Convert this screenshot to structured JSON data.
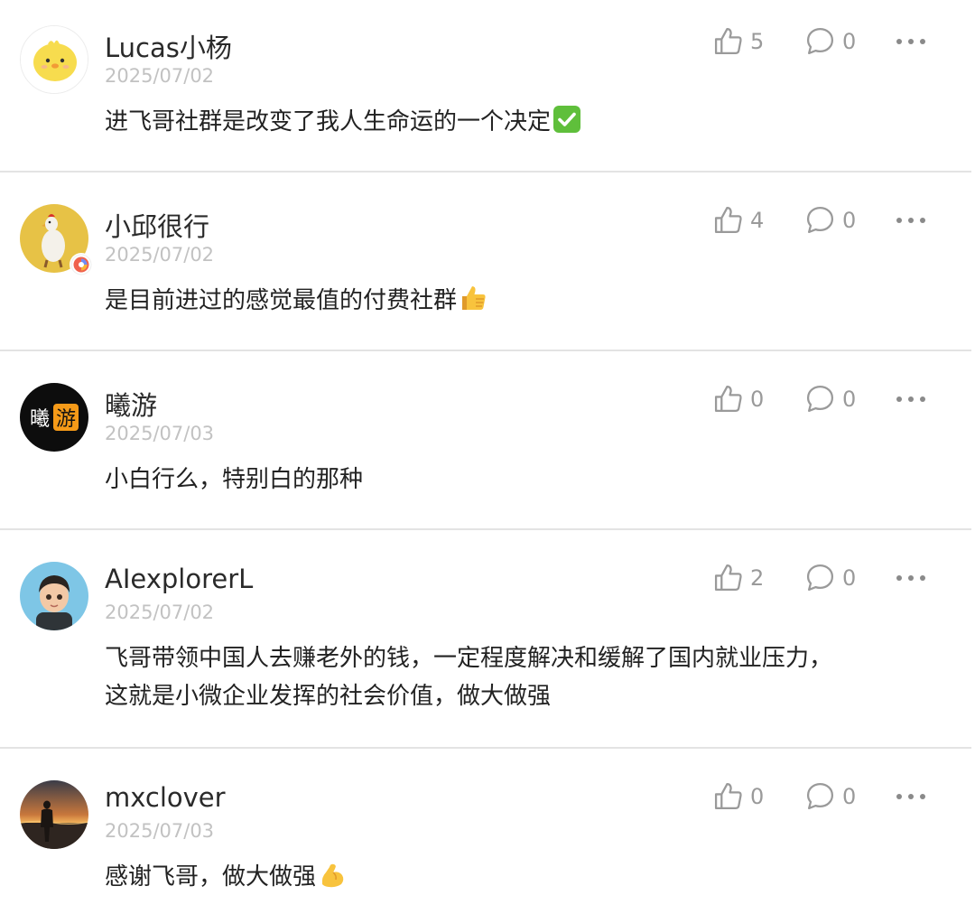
{
  "comments": [
    {
      "username": "Lucas小杨",
      "date": "2025/07/02",
      "text": "进飞哥社群是改变了我人生命运的一个决定",
      "emoji": "✅",
      "likes": "5",
      "replies": "0"
    },
    {
      "username": "小邱很行",
      "date": "2025/07/02",
      "text": "是目前进过的感觉最值的付费社群",
      "emoji": "👍",
      "likes": "4",
      "replies": "0"
    },
    {
      "username": "曦游",
      "date": "2025/07/03",
      "text": "小白行么，特别白的那种",
      "likes": "0",
      "replies": "0",
      "avatar_text": [
        "曦",
        "游"
      ]
    },
    {
      "username": "AIexplorerL",
      "date": "2025/07/02",
      "text_lines": [
        "飞哥带领中国人去赚老外的钱，一定程度解决和缓解了国内就业压力，",
        "这就是小微企业发挥的社会价值，做大做强"
      ],
      "likes": "2",
      "replies": "0"
    },
    {
      "username": "mxclover",
      "date": "2025/07/03",
      "text": "感谢飞哥，做大做强",
      "emoji": "💪",
      "likes": "0",
      "replies": "0"
    }
  ],
  "colors": {
    "text": "#222222",
    "meta": "#9a9a9a",
    "date": "#c2c2c2",
    "divider": "#e3e3e3"
  },
  "icons": [
    "thumbs-up-icon",
    "comment-bubble-icon",
    "more-dots-icon",
    "checkmark-emoji",
    "thumbs-up-emoji",
    "flexed-biceps-emoji"
  ]
}
